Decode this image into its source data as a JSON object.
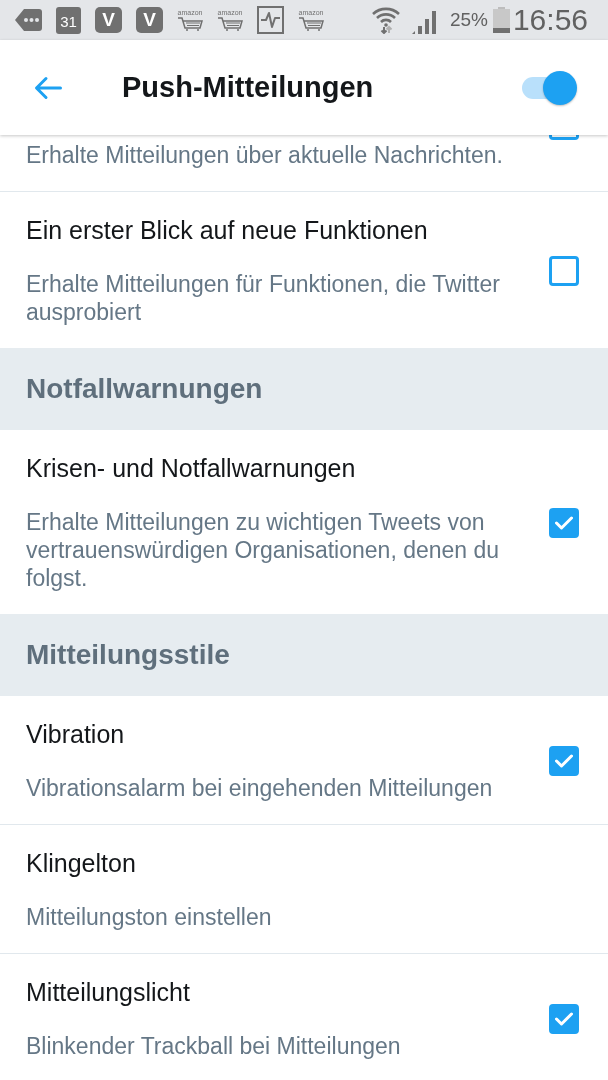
{
  "status_bar": {
    "notification_icons": [
      {
        "kind": "tag"
      },
      {
        "kind": "calendar",
        "label": "31"
      },
      {
        "kind": "letter",
        "label": "V"
      },
      {
        "kind": "letter",
        "label": "V"
      },
      {
        "kind": "cart",
        "label": "amazon"
      },
      {
        "kind": "cart",
        "label": "amazon"
      },
      {
        "kind": "pulse"
      },
      {
        "kind": "cart",
        "label": "amazon"
      }
    ],
    "battery": "25%",
    "time": "16:56"
  },
  "header": {
    "title": "Push-Mitteilungen",
    "toggle": {
      "on": true
    }
  },
  "list": [
    {
      "kind": "clipped",
      "description": "Erhalte Mitteilungen über aktuelle Nachrichten.",
      "checked": false
    },
    {
      "kind": "setting",
      "title": "Ein erster Blick auf neue Funktionen",
      "description": "Erhalte Mitteilungen für Funktionen, die Twitter ausprobiert",
      "checked": false
    },
    {
      "kind": "section",
      "title": "Notfallwarnungen"
    },
    {
      "kind": "setting",
      "title": "Krisen- und Notfallwarnungen",
      "description": "Erhalte Mitteilungen zu wichtigen Tweets von vertrauenswürdigen Organisationen, denen du folgst.",
      "checked": true
    },
    {
      "kind": "section",
      "title": "Mitteilungsstile"
    },
    {
      "kind": "setting",
      "title": "Vibration",
      "description": "Vibrationsalarm bei eingehenden Mitteilungen",
      "checked": true
    },
    {
      "kind": "link",
      "title": "Klingelton",
      "description": "Mitteilungston einstellen"
    },
    {
      "kind": "setting",
      "title": "Mitteilungslicht",
      "description": "Blinkender Trackball bei Mitteilungen",
      "checked": true
    }
  ]
}
